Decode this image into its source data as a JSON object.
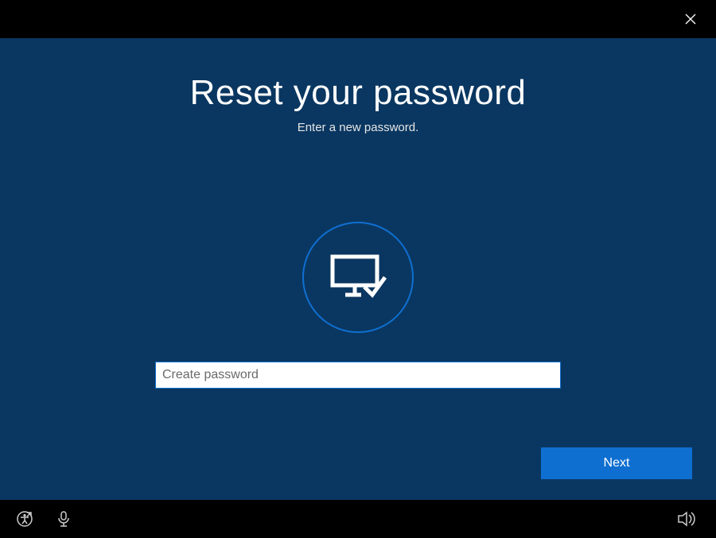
{
  "title": "Reset your password",
  "subtitle": "Enter a new password.",
  "password_input": {
    "placeholder": "Create password",
    "value": ""
  },
  "buttons": {
    "next": "Next"
  },
  "icons": {
    "close": "close-icon",
    "center": "monitor-check-icon",
    "ease_of_access": "ease-of-access-icon",
    "microphone": "microphone-icon",
    "volume": "volume-icon"
  },
  "colors": {
    "background": "#0a3761",
    "accent": "#0f6fd1",
    "bar": "#000000"
  }
}
